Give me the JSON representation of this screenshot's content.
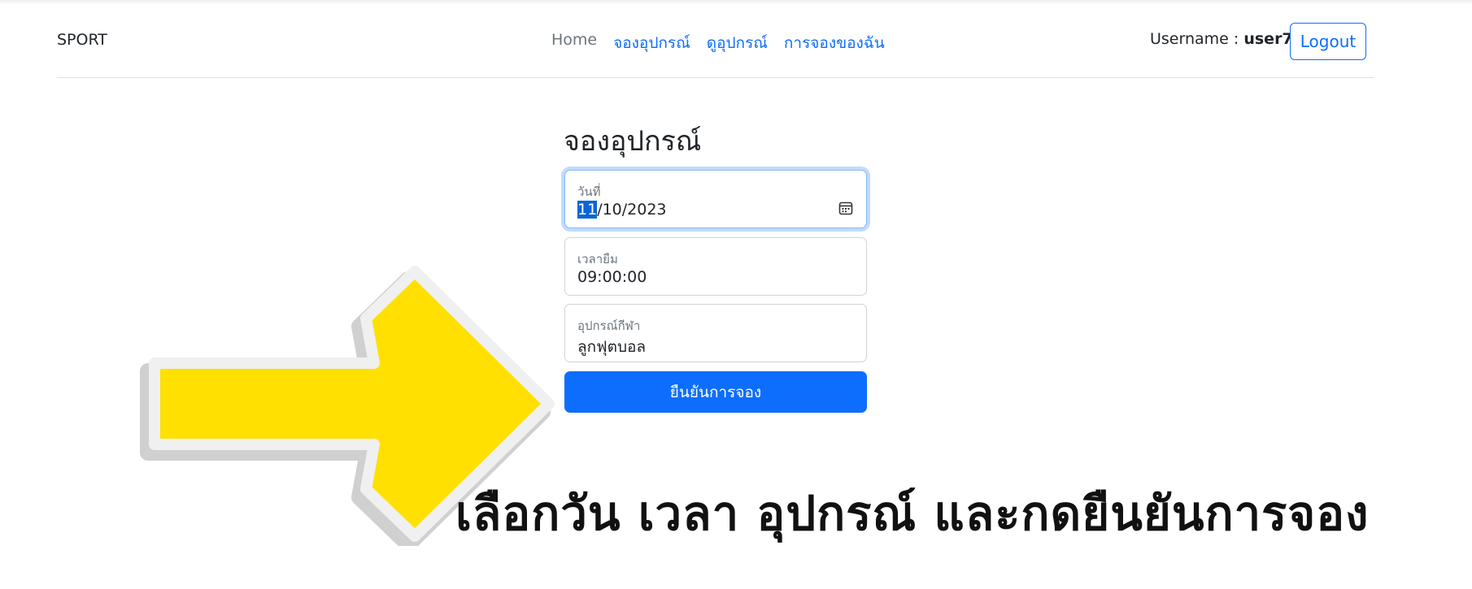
{
  "navbar": {
    "brand": "SPORT",
    "links": [
      {
        "label": "Home"
      },
      {
        "label": "จองอุปกรณ์"
      },
      {
        "label": "ดูอุปกรณ์"
      },
      {
        "label": "การจองของฉัน"
      }
    ],
    "username_prefix": "Username : ",
    "username": "user7",
    "logout_label": "Logout"
  },
  "form": {
    "title": "จองอุปกรณ์",
    "date": {
      "label": "วันที่",
      "day": "11",
      "rest": "/10/2023"
    },
    "time": {
      "label": "เวลายืม",
      "value": "09:00:00"
    },
    "equipment": {
      "label": "อุปกรณ์กีฬา",
      "value": "ลูกฟุตบอล"
    },
    "submit_label": "ยืนยันการจอง"
  },
  "annotation": {
    "text": "เลือกวัน เวลา อุปกรณ์ และกดยืนยันการจอง",
    "arrow_color": "#FFE000"
  },
  "colors": {
    "primary": "#0d6efd",
    "muted": "#6c757d"
  },
  "icons": {
    "date": "calendar-icon"
  }
}
